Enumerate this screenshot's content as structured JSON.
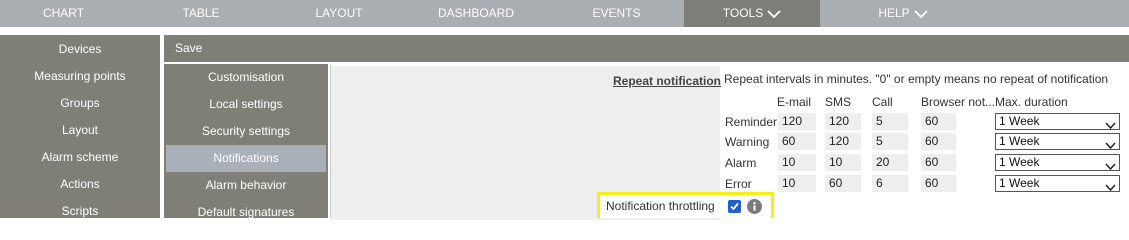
{
  "nav": {
    "tabs": [
      {
        "label": "CHART"
      },
      {
        "label": "TABLE"
      },
      {
        "label": "LAYOUT"
      },
      {
        "label": "DASHBOARD"
      },
      {
        "label": "EVENTS"
      },
      {
        "label": "TOOLS"
      },
      {
        "label": "HELP"
      }
    ]
  },
  "sidebar": {
    "items": [
      {
        "label": "Devices"
      },
      {
        "label": "Measuring points"
      },
      {
        "label": "Groups"
      },
      {
        "label": "Layout"
      },
      {
        "label": "Alarm scheme"
      },
      {
        "label": "Actions"
      },
      {
        "label": "Scripts"
      }
    ]
  },
  "toolbar": {
    "save_label": "Save"
  },
  "subnav": {
    "items": [
      {
        "label": "Customisation"
      },
      {
        "label": "Local settings"
      },
      {
        "label": "Security settings"
      },
      {
        "label": "Notifications"
      },
      {
        "label": "Alarm behavior"
      },
      {
        "label": "Default signatures"
      }
    ]
  },
  "repeat": {
    "title": "Repeat notification",
    "description": "Repeat intervals in minutes. \"0\" or empty means no repeat of notification",
    "columns": [
      "E-mail",
      "SMS",
      "Call",
      "Browser not...",
      "Max. duration"
    ],
    "rows": [
      {
        "label": "Reminder",
        "email": "120",
        "sms": "120",
        "call": "5",
        "browser": "60",
        "duration": "1 Week"
      },
      {
        "label": "Warning",
        "email": "60",
        "sms": "120",
        "call": "5",
        "browser": "60",
        "duration": "1 Week"
      },
      {
        "label": "Alarm",
        "email": "10",
        "sms": "10",
        "call": "20",
        "browser": "60",
        "duration": "1 Week"
      },
      {
        "label": "Error",
        "email": "10",
        "sms": "60",
        "call": "6",
        "browser": "60",
        "duration": "1 Week"
      }
    ]
  },
  "throttling": {
    "label": "Notification throttling",
    "checked": true
  },
  "colors": {
    "nav": "#a9aeb3",
    "sidebar": "#7f7f78",
    "active_sub": "#a9b0b8",
    "highlight": "#f6ee19",
    "checkbox": "#1e62c8"
  }
}
